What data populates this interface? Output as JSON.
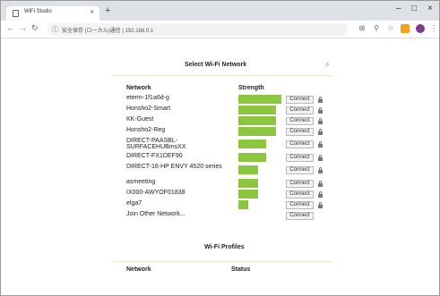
{
  "browser": {
    "tab_title": "WiFi Studio",
    "tab_close": "×",
    "new_tab": "+",
    "url": "安全保存 (ローカル)通信  |  192.168.0.1",
    "minimize": "–",
    "maximize": "□",
    "close": "×"
  },
  "page": {
    "title": "Select Wi-Fi Network",
    "col_network": "Network",
    "col_strength": "Strength",
    "connect_label": "Connect",
    "networks": [
      {
        "name": "eterm-1f1a6d-g",
        "strength": 1.0,
        "locked": true
      },
      {
        "name": "Honsho2-Smart",
        "strength": 0.88,
        "locked": true
      },
      {
        "name": "KK-Guest",
        "strength": 0.88,
        "locked": true
      },
      {
        "name": "Honsho2-Reg",
        "strength": 0.88,
        "locked": true
      },
      {
        "name": "DIRECT-PAASBL-SURFACEHUBmsXX",
        "strength": 0.65,
        "locked": true
      },
      {
        "name": "DIRECT-FX1DEF90",
        "strength": 0.65,
        "locked": true
      },
      {
        "name": "DIRECT-16-HP ENVY 4520 series",
        "strength": 0.45,
        "locked": true
      },
      {
        "name": "asmeeting",
        "strength": 0.45,
        "locked": true
      },
      {
        "name": "IX000-AWYOF01838",
        "strength": 0.45,
        "locked": true
      },
      {
        "name": "elga7",
        "strength": 0.22,
        "locked": true
      },
      {
        "name": "Join Other Network...",
        "strength": 0,
        "locked": false
      }
    ],
    "profiles_title": "Wi-Fi Profiles",
    "profiles_col_network": "Network",
    "profiles_col_status": "Status"
  }
}
